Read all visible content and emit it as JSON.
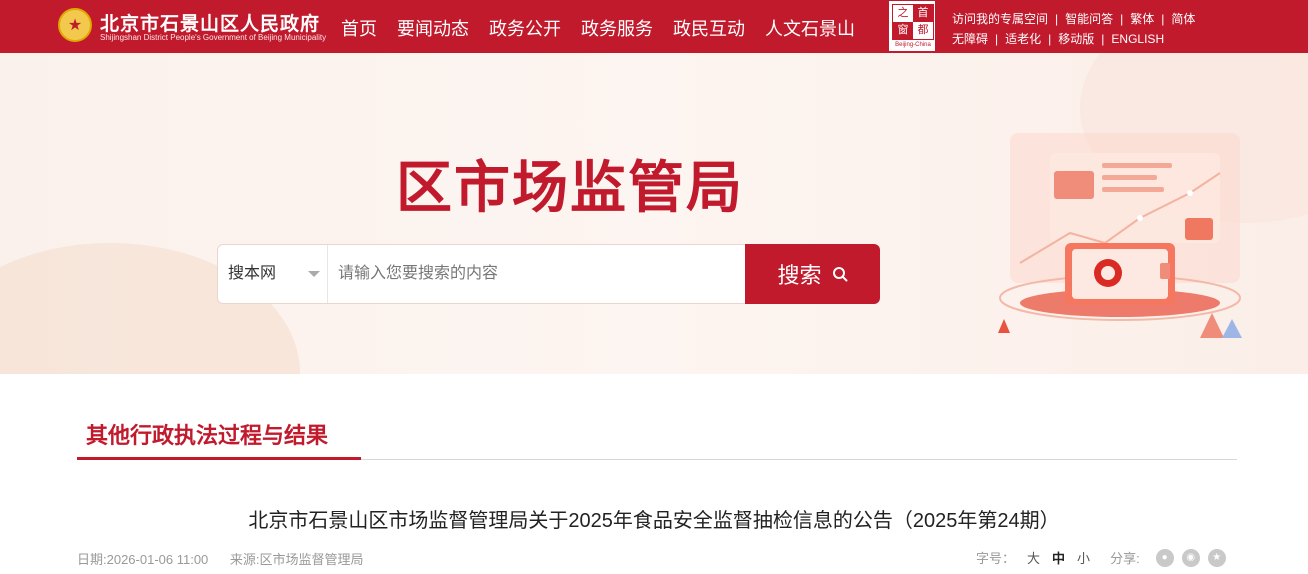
{
  "header": {
    "site_name": "北京市石景山区人民政府",
    "site_name_en": "Shijingshan District People's Government of Beijing Municipality",
    "nav": [
      "首页",
      "要闻动态",
      "政务公开",
      "政务服务",
      "政民互动",
      "人文石景山"
    ],
    "seal_chars": [
      "之",
      "首",
      "窗",
      "都"
    ],
    "seal_caption": "Beijing-China",
    "links_row1": [
      "访问我的专属空间",
      "智能问答",
      "繁体",
      "简体"
    ],
    "links_row2": [
      "无障碍",
      "适老化",
      "移动版",
      "ENGLISH"
    ]
  },
  "banner": {
    "title": "区市场监管局",
    "search": {
      "scope": "搜本网",
      "placeholder": "请输入您要搜索的内容",
      "button_label": "搜索"
    }
  },
  "section": {
    "title": "其他行政执法过程与结果"
  },
  "article": {
    "title": "北京市石景山区市场监督管理局关于2025年食品安全监督抽检信息的公告（2025年第24期）",
    "date": "日期:2026-01-06 11:00",
    "source": "来源:区市场监督管理局",
    "font_size_label": "字号：",
    "font_sizes": [
      "大",
      "中",
      "小"
    ],
    "share_label": "分享:"
  },
  "colors": {
    "brand_red": "#c11a2d",
    "banner_bg": "#fbf1ec"
  }
}
